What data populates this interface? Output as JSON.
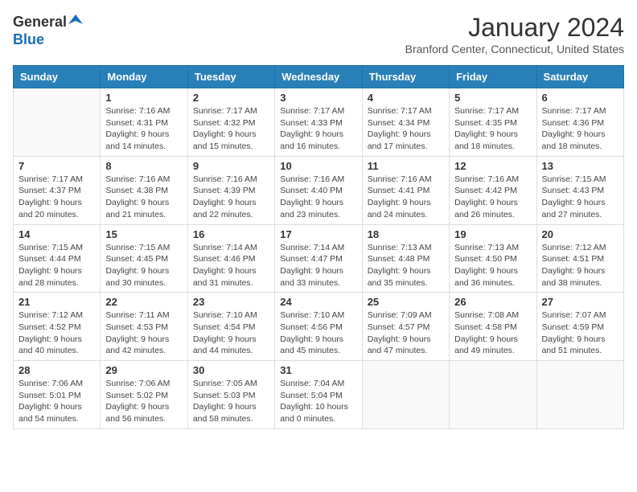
{
  "header": {
    "logo_general": "General",
    "logo_blue": "Blue",
    "month_year": "January 2024",
    "location": "Branford Center, Connecticut, United States"
  },
  "days_of_week": [
    "Sunday",
    "Monday",
    "Tuesday",
    "Wednesday",
    "Thursday",
    "Friday",
    "Saturday"
  ],
  "weeks": [
    [
      {
        "day": "",
        "info": ""
      },
      {
        "day": "1",
        "info": "Sunrise: 7:16 AM\nSunset: 4:31 PM\nDaylight: 9 hours\nand 14 minutes."
      },
      {
        "day": "2",
        "info": "Sunrise: 7:17 AM\nSunset: 4:32 PM\nDaylight: 9 hours\nand 15 minutes."
      },
      {
        "day": "3",
        "info": "Sunrise: 7:17 AM\nSunset: 4:33 PM\nDaylight: 9 hours\nand 16 minutes."
      },
      {
        "day": "4",
        "info": "Sunrise: 7:17 AM\nSunset: 4:34 PM\nDaylight: 9 hours\nand 17 minutes."
      },
      {
        "day": "5",
        "info": "Sunrise: 7:17 AM\nSunset: 4:35 PM\nDaylight: 9 hours\nand 18 minutes."
      },
      {
        "day": "6",
        "info": "Sunrise: 7:17 AM\nSunset: 4:36 PM\nDaylight: 9 hours\nand 18 minutes."
      }
    ],
    [
      {
        "day": "7",
        "info": "Sunrise: 7:17 AM\nSunset: 4:37 PM\nDaylight: 9 hours\nand 20 minutes."
      },
      {
        "day": "8",
        "info": "Sunrise: 7:16 AM\nSunset: 4:38 PM\nDaylight: 9 hours\nand 21 minutes."
      },
      {
        "day": "9",
        "info": "Sunrise: 7:16 AM\nSunset: 4:39 PM\nDaylight: 9 hours\nand 22 minutes."
      },
      {
        "day": "10",
        "info": "Sunrise: 7:16 AM\nSunset: 4:40 PM\nDaylight: 9 hours\nand 23 minutes."
      },
      {
        "day": "11",
        "info": "Sunrise: 7:16 AM\nSunset: 4:41 PM\nDaylight: 9 hours\nand 24 minutes."
      },
      {
        "day": "12",
        "info": "Sunrise: 7:16 AM\nSunset: 4:42 PM\nDaylight: 9 hours\nand 26 minutes."
      },
      {
        "day": "13",
        "info": "Sunrise: 7:15 AM\nSunset: 4:43 PM\nDaylight: 9 hours\nand 27 minutes."
      }
    ],
    [
      {
        "day": "14",
        "info": "Sunrise: 7:15 AM\nSunset: 4:44 PM\nDaylight: 9 hours\nand 28 minutes."
      },
      {
        "day": "15",
        "info": "Sunrise: 7:15 AM\nSunset: 4:45 PM\nDaylight: 9 hours\nand 30 minutes."
      },
      {
        "day": "16",
        "info": "Sunrise: 7:14 AM\nSunset: 4:46 PM\nDaylight: 9 hours\nand 31 minutes."
      },
      {
        "day": "17",
        "info": "Sunrise: 7:14 AM\nSunset: 4:47 PM\nDaylight: 9 hours\nand 33 minutes."
      },
      {
        "day": "18",
        "info": "Sunrise: 7:13 AM\nSunset: 4:48 PM\nDaylight: 9 hours\nand 35 minutes."
      },
      {
        "day": "19",
        "info": "Sunrise: 7:13 AM\nSunset: 4:50 PM\nDaylight: 9 hours\nand 36 minutes."
      },
      {
        "day": "20",
        "info": "Sunrise: 7:12 AM\nSunset: 4:51 PM\nDaylight: 9 hours\nand 38 minutes."
      }
    ],
    [
      {
        "day": "21",
        "info": "Sunrise: 7:12 AM\nSunset: 4:52 PM\nDaylight: 9 hours\nand 40 minutes."
      },
      {
        "day": "22",
        "info": "Sunrise: 7:11 AM\nSunset: 4:53 PM\nDaylight: 9 hours\nand 42 minutes."
      },
      {
        "day": "23",
        "info": "Sunrise: 7:10 AM\nSunset: 4:54 PM\nDaylight: 9 hours\nand 44 minutes."
      },
      {
        "day": "24",
        "info": "Sunrise: 7:10 AM\nSunset: 4:56 PM\nDaylight: 9 hours\nand 45 minutes."
      },
      {
        "day": "25",
        "info": "Sunrise: 7:09 AM\nSunset: 4:57 PM\nDaylight: 9 hours\nand 47 minutes."
      },
      {
        "day": "26",
        "info": "Sunrise: 7:08 AM\nSunset: 4:58 PM\nDaylight: 9 hours\nand 49 minutes."
      },
      {
        "day": "27",
        "info": "Sunrise: 7:07 AM\nSunset: 4:59 PM\nDaylight: 9 hours\nand 51 minutes."
      }
    ],
    [
      {
        "day": "28",
        "info": "Sunrise: 7:06 AM\nSunset: 5:01 PM\nDaylight: 9 hours\nand 54 minutes."
      },
      {
        "day": "29",
        "info": "Sunrise: 7:06 AM\nSunset: 5:02 PM\nDaylight: 9 hours\nand 56 minutes."
      },
      {
        "day": "30",
        "info": "Sunrise: 7:05 AM\nSunset: 5:03 PM\nDaylight: 9 hours\nand 58 minutes."
      },
      {
        "day": "31",
        "info": "Sunrise: 7:04 AM\nSunset: 5:04 PM\nDaylight: 10 hours\nand 0 minutes."
      },
      {
        "day": "",
        "info": ""
      },
      {
        "day": "",
        "info": ""
      },
      {
        "day": "",
        "info": ""
      }
    ]
  ]
}
